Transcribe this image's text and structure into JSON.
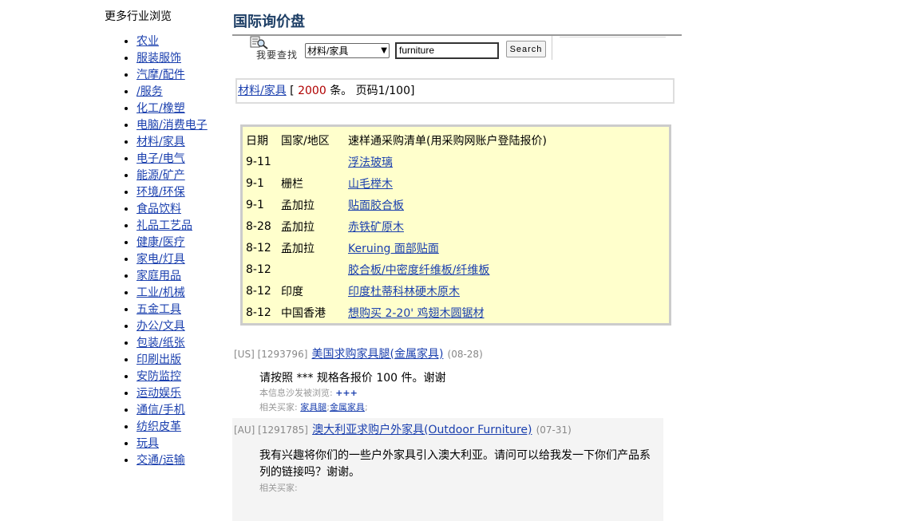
{
  "sidebar": {
    "title": "更多行业浏览",
    "items": [
      {
        "label": "农业"
      },
      {
        "label": "服装服饰"
      },
      {
        "label": "汽摩/配件"
      },
      {
        "label": "/服务"
      },
      {
        "label": "化工/橡塑"
      },
      {
        "label": "电脑/消费电子"
      },
      {
        "label": "材料/家具"
      },
      {
        "label": "电子/电气"
      },
      {
        "label": "能源/矿产"
      },
      {
        "label": "环境/环保"
      },
      {
        "label": "食品饮料"
      },
      {
        "label": "礼品工艺品"
      },
      {
        "label": "健康/医疗"
      },
      {
        "label": "家电/灯具"
      },
      {
        "label": "家庭用品"
      },
      {
        "label": "工业/机械"
      },
      {
        "label": "五金工具"
      },
      {
        "label": "办公/文具"
      },
      {
        "label": "包装/纸张"
      },
      {
        "label": "印刷出版"
      },
      {
        "label": "安防监控"
      },
      {
        "label": "运动娱乐"
      },
      {
        "label": "通信/手机"
      },
      {
        "label": "纺织皮革"
      },
      {
        "label": "玩具"
      },
      {
        "label": "交通/运输"
      }
    ]
  },
  "page": {
    "title": "国际询价盘"
  },
  "search": {
    "label": "我要查找",
    "category": "材料/家具",
    "query": "furniture",
    "button": "Search",
    "icon": "search-icon"
  },
  "summary": {
    "category": "材料/家具",
    "open": "[",
    "count": "2000",
    "unit": "条。",
    "page": "页码1/100]"
  },
  "table": {
    "headers": {
      "date": "日期",
      "country": "国家/地区",
      "title": "速样通采购清单(用采购网账户登陆报价)"
    },
    "rows": [
      {
        "date": "9-11",
        "country": "",
        "title": "浮法玻璃"
      },
      {
        "date": "9-1",
        "country": "栅栏",
        "title": "山毛榉木"
      },
      {
        "date": "9-1",
        "country": "孟加拉",
        "title": "贴面胶合板"
      },
      {
        "date": "8-28",
        "country": "孟加拉",
        "title": "赤铁矿原木"
      },
      {
        "date": "8-12",
        "country": "孟加拉",
        "title": "Keruing 面部贴面"
      },
      {
        "date": "8-12",
        "country": "",
        "title": "胶合板/中密度纤维板/纤维板"
      },
      {
        "date": "8-12",
        "country": "印度",
        "title": "印度杜蒂科林硬木原木"
      },
      {
        "date": "8-12",
        "country": "中国香港",
        "title": "想购买 2-20' 鸡翅木圆锯材"
      }
    ]
  },
  "entries": [
    {
      "code": "[US] [1293796]",
      "title": "美国求购家具腿(金属家具)",
      "date": "(08-28)",
      "body": "请按照 *** 规格各报价 100 件。谢谢",
      "views_label": "本信息沙发被浏览:",
      "views": "+++",
      "related_label": "相关买家:",
      "related": [
        "家具腿",
        "金属家具"
      ],
      "sep": ";",
      "trail": ";"
    },
    {
      "code": "[AU] [1291785]",
      "title": "澳大利亚求购户外家具(Outdoor Furniture)",
      "date": "(07-31)",
      "body": "我有兴趣将你们的一些户外家具引入澳大利亚。请问可以给我发一下你们产品系列的链接吗？谢谢。",
      "related_label": "相关买家:"
    }
  ]
}
